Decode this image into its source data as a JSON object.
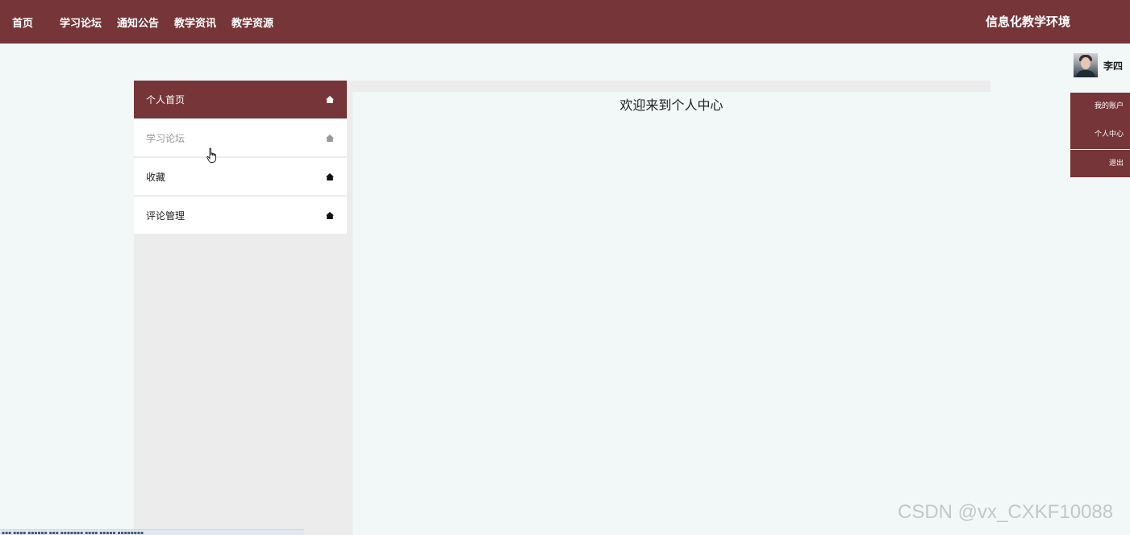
{
  "nav": {
    "items": [
      {
        "label": "首页"
      },
      {
        "label": "学习论坛"
      },
      {
        "label": "通知公告"
      },
      {
        "label": "教学资讯"
      },
      {
        "label": "教学资源"
      }
    ],
    "site_title": "信息化教学环境"
  },
  "user": {
    "name": "李四",
    "menu": [
      "我的账户",
      "个人中心",
      "退出"
    ]
  },
  "sidebar": {
    "items": [
      {
        "label": "个人首页",
        "icon": "home-icon",
        "state": "active"
      },
      {
        "label": "学习论坛",
        "icon": "home-icon",
        "state": "hover"
      },
      {
        "label": "收藏",
        "icon": "home-icon",
        "state": "normal"
      },
      {
        "label": "评论管理",
        "icon": "home-icon",
        "state": "normal"
      }
    ]
  },
  "main": {
    "welcome": "欢迎来到个人中心"
  },
  "watermark": "CSDN @vx_CXKF10088",
  "colors": {
    "brand": "#763538",
    "page_bg": "#f2f7f7",
    "panel_bg": "#ececec"
  }
}
